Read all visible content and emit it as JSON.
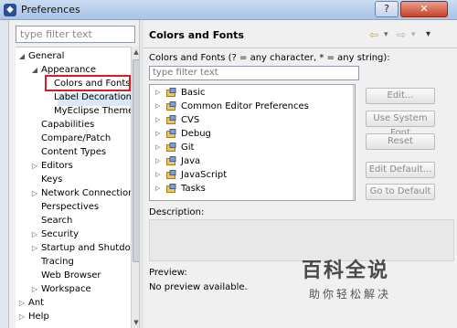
{
  "window": {
    "title": "Preferences",
    "help_label": "?",
    "close_label": "✕"
  },
  "tree": {
    "filter_placeholder": "type filter text",
    "items": [
      {
        "label": "General",
        "twisty": "◢"
      },
      {
        "label": "Appearance",
        "twisty": "◢"
      },
      {
        "label": "Colors and Fonts",
        "twisty": ""
      },
      {
        "label": "Label Decorations",
        "twisty": ""
      },
      {
        "label": "MyEclipse Themes",
        "twisty": ""
      },
      {
        "label": "Capabilities",
        "twisty": ""
      },
      {
        "label": "Compare/Patch",
        "twisty": ""
      },
      {
        "label": "Content Types",
        "twisty": ""
      },
      {
        "label": "Editors",
        "twisty": "▷"
      },
      {
        "label": "Keys",
        "twisty": ""
      },
      {
        "label": "Network Connections",
        "twisty": "▷"
      },
      {
        "label": "Perspectives",
        "twisty": ""
      },
      {
        "label": "Search",
        "twisty": ""
      },
      {
        "label": "Security",
        "twisty": "▷"
      },
      {
        "label": "Startup and Shutdown",
        "twisty": "▷"
      },
      {
        "label": "Tracing",
        "twisty": ""
      },
      {
        "label": "Web Browser",
        "twisty": ""
      },
      {
        "label": "Workspace",
        "twisty": "▷"
      },
      {
        "label": "Ant",
        "twisty": "▷"
      },
      {
        "label": "Help",
        "twisty": "▷"
      }
    ],
    "selected": "Colors and Fonts"
  },
  "page": {
    "title": "Colors and Fonts",
    "help_text": "Colors and Fonts (? = any character, * = any string):",
    "filter_placeholder": "type filter text",
    "nav": {
      "back": "⇦",
      "back_menu": "▾",
      "forward": "⇨",
      "forward_menu": "▾",
      "view_menu": "▾"
    },
    "categories": [
      "Basic",
      "Common Editor Preferences",
      "CVS",
      "Debug",
      "Git",
      "Java",
      "JavaScript",
      "Tasks"
    ],
    "buttons": {
      "edit": "Edit...",
      "use_system_font": "Use System Font",
      "reset": "Reset",
      "edit_default": "Edit Default...",
      "go_to_default": "Go to Default"
    },
    "description_label": "Description:",
    "preview_label": "Preview:",
    "preview_text": "No preview available."
  },
  "watermark": {
    "logo": "百科全说",
    "sub": "助你轻松解决"
  },
  "colors": {
    "selection_highlight": "#e0191f",
    "title_gradient_top": "#c9dcf2",
    "close_button": "#c7422a"
  }
}
